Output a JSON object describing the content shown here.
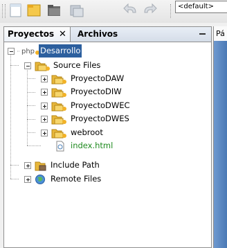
{
  "toolbar": {
    "config_value": "<default>",
    "icons": [
      "new-file-icon",
      "new-project-icon",
      "open-project-icon",
      "save-all-icon",
      "undo-icon",
      "redo-icon"
    ]
  },
  "panel": {
    "tabs": [
      {
        "label": "Proyectos",
        "active": true
      },
      {
        "label": "Archivos",
        "active": false
      }
    ]
  },
  "tree": {
    "root": "Desarrollo",
    "source_files": "Source Files",
    "projects": [
      "ProyectoDAW",
      "ProyectoDIW",
      "ProyectoDWEC",
      "ProyectoDWES",
      "webroot"
    ],
    "file": "index.html",
    "include_path": "Include Path",
    "remote_files": "Remote Files"
  },
  "editor": {
    "tab_label": "Pá"
  },
  "colors": {
    "selection": "#2c5f9e",
    "folder": "#e8b73a",
    "file_text": "#1f8a1f",
    "editor_bg": "#5a86c0"
  }
}
